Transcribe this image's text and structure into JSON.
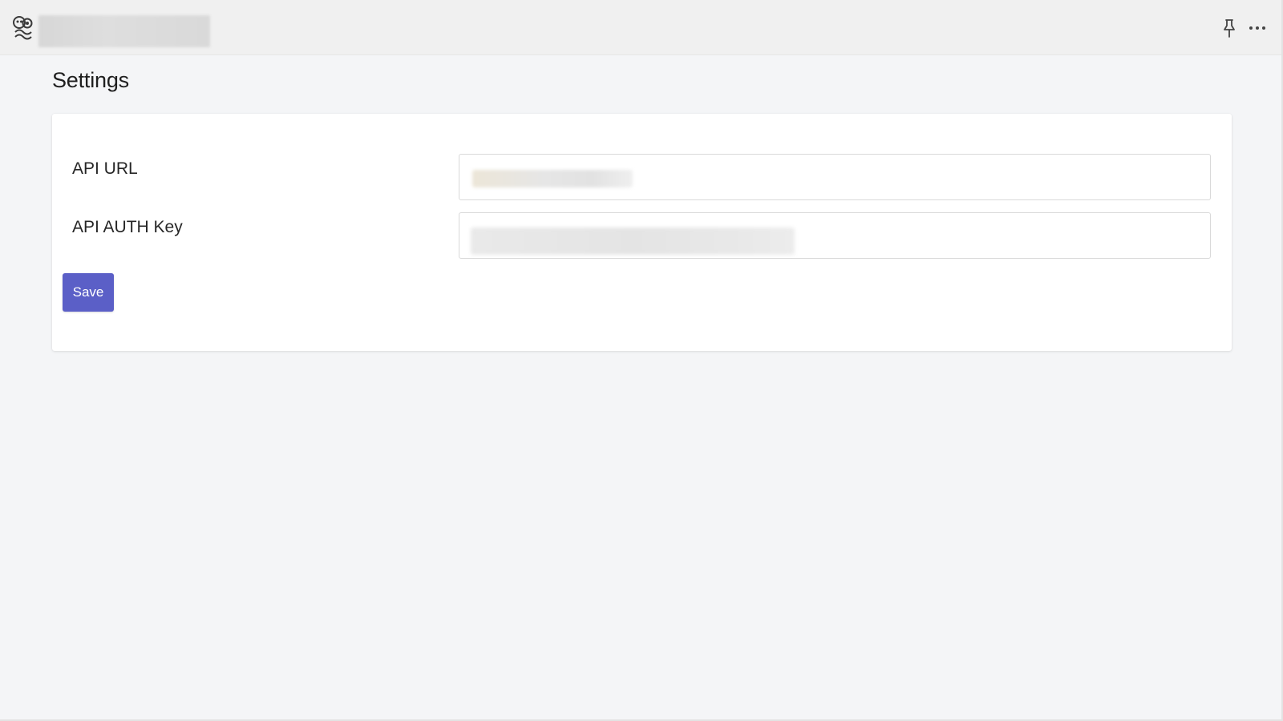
{
  "header": {
    "app_icon": "bot-settings-icon",
    "app_name": "",
    "pin_icon": "pin-icon",
    "more_icon": "more-options-icon"
  },
  "page": {
    "title": "Settings"
  },
  "form": {
    "api_url": {
      "label": "API URL",
      "value": ""
    },
    "api_auth_key": {
      "label": "API AUTH Key",
      "value": ""
    },
    "save_label": "Save"
  },
  "colors": {
    "accent": "#5b5fc7",
    "page_background": "#f4f5f7",
    "header_background": "#f0f0f0",
    "card_background": "#ffffff"
  }
}
